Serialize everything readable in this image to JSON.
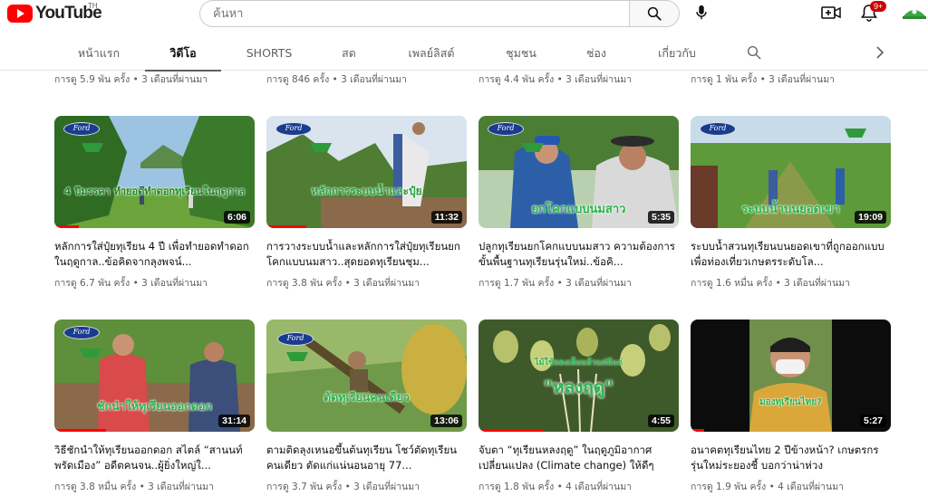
{
  "header": {
    "logo_text": "YouTube",
    "logo_region": "TH",
    "search_placeholder": "ค้นหา",
    "notification_count": "9+"
  },
  "tabs": [
    {
      "label": "หน้าแรก",
      "active": false
    },
    {
      "label": "วิดีโอ",
      "active": true
    },
    {
      "label": "SHORTS",
      "active": false
    },
    {
      "label": "สด",
      "active": false
    },
    {
      "label": "เพลย์ลิสต์",
      "active": false
    },
    {
      "label": "ชุมชน",
      "active": false
    },
    {
      "label": "ช่อง",
      "active": false
    },
    {
      "label": "เกี่ยวกับ",
      "active": false
    }
  ],
  "top_row_meta": [
    "การดู 5.9 พัน ครั้ง • 3 เดือนที่ผ่านมา",
    "การดู 846 ครั้ง • 3 เดือนที่ผ่านมา",
    "การดู 4.4 พัน ครั้ง • 3 เดือนที่ผ่านมา",
    "การดู 1 พัน ครั้ง • 3 เดือนที่ผ่านมา"
  ],
  "videos": [
    {
      "title": "หลักการใส่ปุ๋ยทุเรียน 4 ปี เพื่อทำยอดทำดอกในฤดูกาล..ข้อคิดจากลุงพจน์...",
      "meta": "การดู 6.7 พัน ครั้ง • 3 เดือนที่ผ่านมา",
      "duration": "6:06",
      "progress": 0.12,
      "overlay": "4 ปีมรรคา ทำยอดทำดอกทุเรียนในฤดูกาล"
    },
    {
      "title": "การวางระบบน้ำและหลักการใส่ปุ๋ยทุเรียนยกโคกแบบนมสาว..สุดยอดทุเรียนชุม...",
      "meta": "การดู 3.8 พัน ครั้ง • 3 เดือนที่ผ่านมา",
      "duration": "11:32",
      "progress": 0.2,
      "overlay": "หลักการระบบน้ำและปุ๋ย"
    },
    {
      "title": "ปลูกทุเรียนยกโคกแบบนมสาว ความต้องการขั้นพื้นฐานทุเรียนรุ่นใหม่..ข้อคิ...",
      "meta": "การดู 1.7 พัน ครั้ง • 3 เดือนที่ผ่านมา",
      "duration": "5:35",
      "progress": 0.0,
      "overlay": "ยกโคกแบบนมสาว"
    },
    {
      "title": "ระบบน้ำสวนทุเรียนบนยอดเขาที่ถูกออกแบบเพื่อท่องเที่ยวเกษตรระดับโล...",
      "meta": "การดู 1.6 หมื่น ครั้ง • 3 เดือนที่ผ่านมา",
      "duration": "19:09",
      "progress": 0.0,
      "overlay": "ระบบน้ำบนยอดเขา"
    },
    {
      "title": "วิธีชักนำให้ทุเรียนออกดอก สไตล์ “สานนท์ พรัดเมือง” อดีตคนจน..ผู้ยิ่งใหญ่ใ...",
      "meta": "การดู 3.8 หมื่น ครั้ง • 3 เดือนที่ผ่านมา",
      "duration": "31:14",
      "progress": 0.26,
      "overlay": "ชักนำให้ทุเรียนออกดอก"
    },
    {
      "title": "ตามติดลุงเหนอขึ้นต้นทุเรียน โชว์ตัดทุเรียนคนเดียว ตัดแก่แน่นอนอายุ 77...",
      "meta": "การดู 3.7 พัน ครั้ง • 3 เดือนที่ผ่านมา",
      "duration": "13:06",
      "progress": 0.0,
      "overlay": "ตัดทุเรียนคนเดียว"
    },
    {
      "title": "จับตา “ทุเรียนหลงฤดู” ในฤดูภูมิอากาศเปลี่ยนแปลง (Climate change) ให้ดีๆ",
      "meta": "การดู 1.8 พัน ครั้ง • 4 เดือนที่ผ่านมา",
      "duration": "4:55",
      "progress": 0.32,
      "overlay": "\"หลงฤดู\""
    },
    {
      "title": "อนาคตทุเรียนไทย 2 ปีข้างหน้า? เกษตรกรรุ่นใหม่ระยองชี้ บอกว่าน่าห่วง",
      "meta": "การดู 1.9 พัน ครั้ง • 4 เดือนที่ผ่านมา",
      "duration": "5:27",
      "progress": 0.07,
      "overlay": "มองทุเรียนไทย?"
    }
  ]
}
